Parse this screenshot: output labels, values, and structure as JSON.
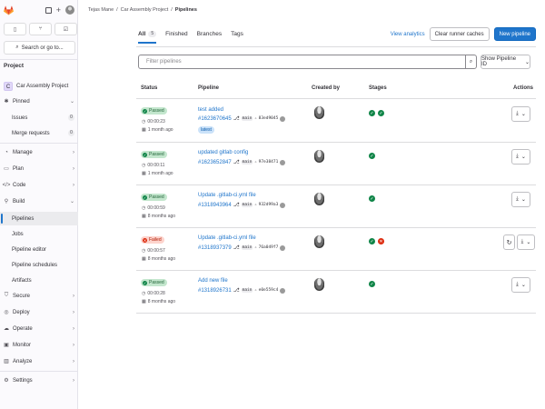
{
  "breadcrumb": [
    "Tejas Mane",
    "Car Assembly Project",
    "Pipelines"
  ],
  "sidebar": {
    "search_label": "Search or go to...",
    "section_heading": "Project",
    "project": {
      "initial": "C",
      "name": "Car Assembly Project"
    },
    "pinned": {
      "label": "Pinned",
      "items": [
        {
          "label": "Issues",
          "count": "0"
        },
        {
          "label": "Merge requests",
          "count": "0"
        }
      ]
    },
    "groups": [
      {
        "label": "Manage"
      },
      {
        "label": "Plan"
      },
      {
        "label": "Code"
      }
    ],
    "build": {
      "label": "Build",
      "items": [
        "Pipelines",
        "Jobs",
        "Pipeline editor",
        "Pipeline schedules",
        "Artifacts"
      ]
    },
    "groups2": [
      {
        "label": "Secure"
      },
      {
        "label": "Deploy"
      },
      {
        "label": "Operate"
      },
      {
        "label": "Monitor"
      },
      {
        "label": "Analyze"
      }
    ],
    "settings": "Settings"
  },
  "tabs": [
    {
      "label": "All",
      "count": "5"
    },
    {
      "label": "Finished"
    },
    {
      "label": "Branches"
    },
    {
      "label": "Tags"
    }
  ],
  "actions": {
    "analytics": "View analytics",
    "clear": "Clear runner caches",
    "new": "New pipeline"
  },
  "filter": {
    "placeholder": "Filter pipelines",
    "show": "Show Pipeline ID"
  },
  "columns": {
    "status": "Status",
    "pipeline": "Pipeline",
    "created_by": "Created by",
    "stages": "Stages",
    "actions": "Actions"
  },
  "rows": [
    {
      "status": "Passed",
      "duration": "00:00:23",
      "ago": "1 month ago",
      "title": "test added",
      "id": "#1623670645",
      "branch": "main",
      "sha": "83ed9045",
      "latest": "latest",
      "stages": [
        "ok",
        "ok"
      ]
    },
    {
      "status": "Passed",
      "duration": "00:00:11",
      "ago": "1 month ago",
      "title": "updated gitlab config",
      "id": "#1623652847",
      "branch": "main",
      "sha": "97e38471",
      "stages": [
        "ok"
      ]
    },
    {
      "status": "Passed",
      "duration": "00:00:59",
      "ago": "8 months ago",
      "title": "Update .gitlab-ci.yml file",
      "id": "#1318943964",
      "branch": "main",
      "sha": "932d99a3",
      "stages": [
        "ok"
      ]
    },
    {
      "status": "Failed",
      "duration": "00:00:57",
      "ago": "8 months ago",
      "title": "Update .gitlab-ci.yml file",
      "id": "#1318937379",
      "branch": "main",
      "sha": "76a049f7",
      "stages": [
        "ok",
        "bad"
      ]
    },
    {
      "status": "Passed",
      "duration": "00:00:28",
      "ago": "8 months ago",
      "title": "Add new file",
      "id": "#1318926731",
      "branch": "main",
      "sha": "e0e559c4",
      "stages": [
        "ok"
      ]
    }
  ],
  "colors": {
    "accent": "#1f75cb",
    "success": "#108548",
    "danger": "#dd2b0e",
    "brand": "#e24329"
  }
}
